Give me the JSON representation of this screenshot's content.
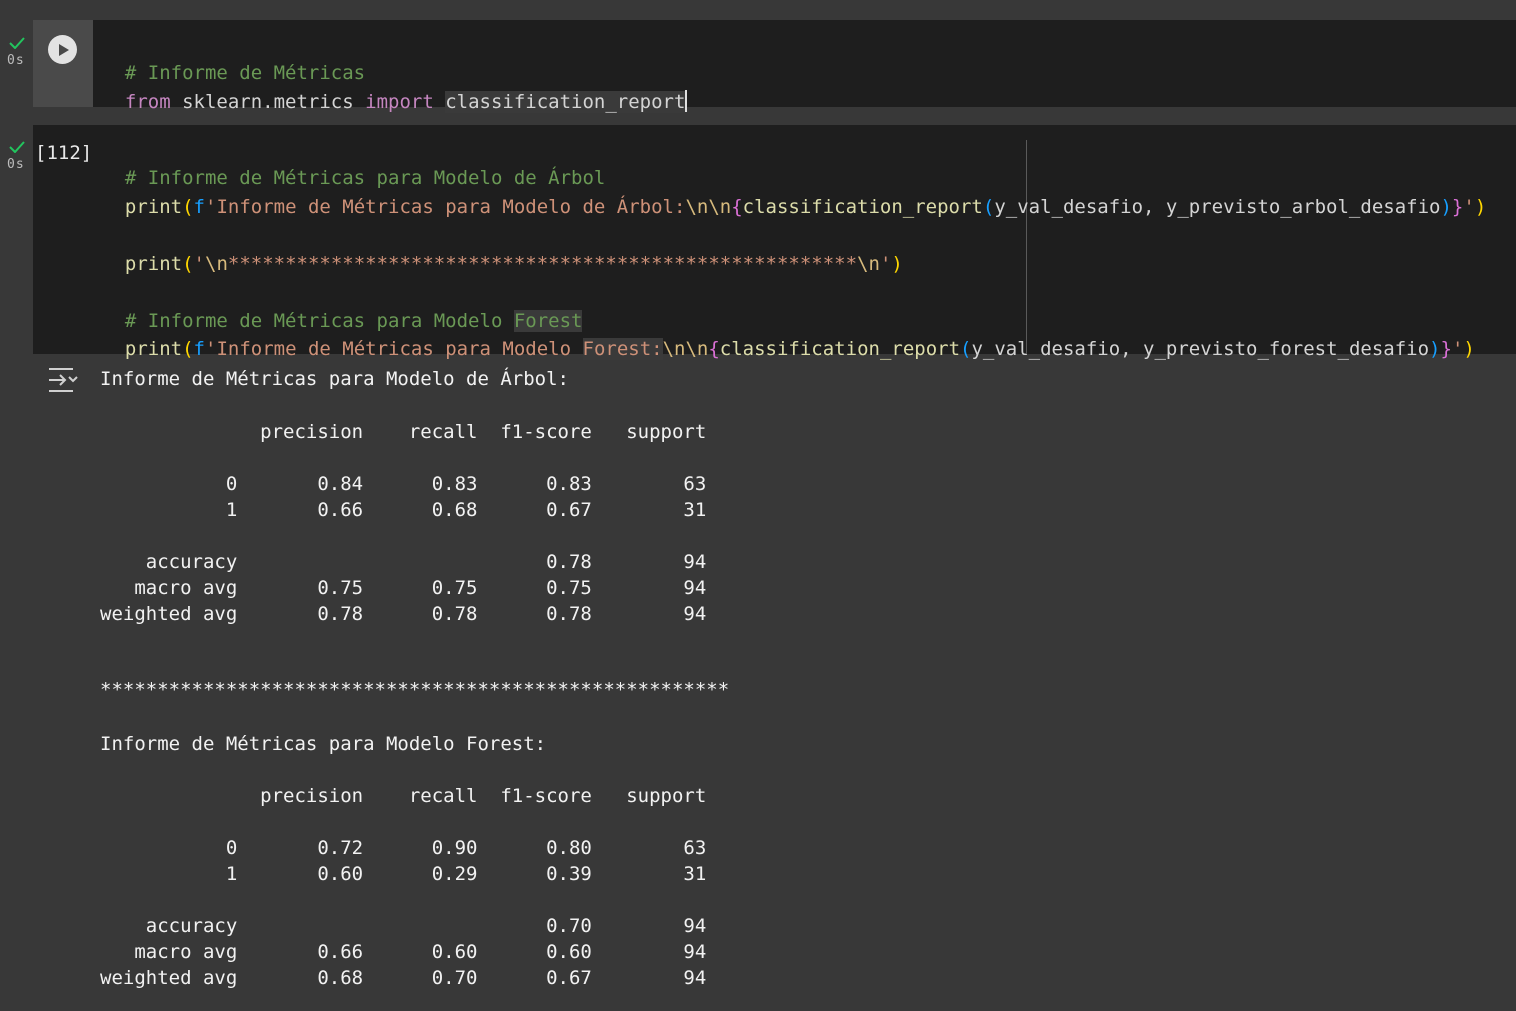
{
  "cell1": {
    "status": "✓",
    "exec_time": "0s",
    "line1_comment": "# Informe de Métricas",
    "line2_kw1": "from",
    "line2_mod": " sklearn.metrics ",
    "line2_kw2": "import",
    "line2_sp": " ",
    "line2_name": "classification_report"
  },
  "cell2": {
    "status": "✓",
    "exec_time": "0s",
    "exec_count": "[112]",
    "l1_comment": "# Informe de Métricas para Modelo de Árbol",
    "l2_print": "print",
    "l2_p1": "(",
    "l2_f": "f",
    "l2_str": "'Informe de Métricas para Modelo de Árbol:",
    "l2_esc": "\\n\\n",
    "l2_b1": "{",
    "l2_fn": "classification_report",
    "l2_p2": "(",
    "l2_args": "y_val_desafio, y_previsto_arbol_desafio",
    "l2_p3": ")",
    "l2_b2": "}",
    "l2_end": "'",
    "l2_p4": ")",
    "l3_print": "print",
    "l3_p1": "(",
    "l3_str1": "'",
    "l3_esc1": "\\n",
    "l3_stars": "*******************************************************",
    "l3_esc2": "\\n",
    "l3_str2": "'",
    "l3_p2": ")",
    "l4_comment_a": "# Informe de Métricas para Modelo ",
    "l4_comment_b": "Forest",
    "l5_print": "print",
    "l5_p1": "(",
    "l5_f": "f",
    "l5_str_a": "'Informe de Métricas para Modelo ",
    "l5_str_b": "Forest:",
    "l5_esc": "\\n\\n",
    "l5_b1": "{",
    "l5_fn": "classification_report",
    "l5_p2": "(",
    "l5_args": "y_val_desafio, y_previsto_forest_desafio",
    "l5_p3": ")",
    "l5_b2": "}",
    "l5_end": "'",
    "l5_p4": ")"
  },
  "output": {
    "lines": [
      "Informe de Métricas para Modelo de Árbol:",
      "",
      "              precision    recall  f1-score   support",
      "",
      "           0       0.84      0.83      0.83        63",
      "           1       0.66      0.68      0.67        31",
      "",
      "    accuracy                           0.78        94",
      "   macro avg       0.75      0.75      0.75        94",
      "weighted avg       0.78      0.78      0.78        94",
      "",
      "",
      "*******************************************************",
      "",
      "Informe de Métricas para Modelo Forest:",
      "",
      "              precision    recall  f1-score   support",
      "",
      "           0       0.72      0.90      0.80        63",
      "           1       0.60      0.29      0.39        31",
      "",
      "    accuracy                           0.70        94",
      "   macro avg       0.66      0.60      0.60        94",
      "weighted avg       0.68      0.70      0.67        94"
    ]
  }
}
